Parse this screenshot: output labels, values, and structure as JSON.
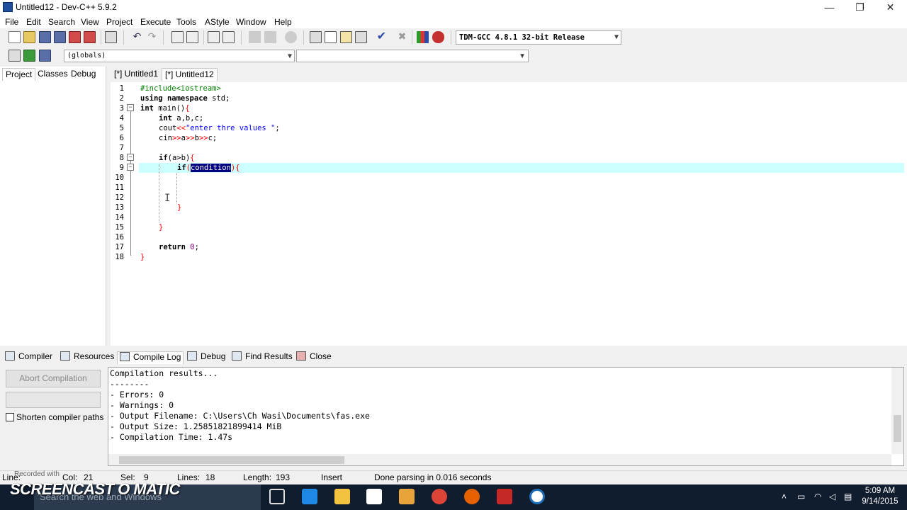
{
  "window": {
    "title": "Untitled12 - Dev-C++ 5.9.2",
    "minimize_glyph": "—",
    "restore_glyph": "❐",
    "close_glyph": "✕"
  },
  "menu": [
    "File",
    "Edit",
    "Search",
    "View",
    "Project",
    "Execute",
    "Tools",
    "AStyle",
    "Window",
    "Help"
  ],
  "toolbar": {
    "compiler": "TDM-GCC 4.8.1 32-bit Release",
    "scope": "(globals)"
  },
  "left_tabs": [
    "Project",
    "Classes",
    "Debug"
  ],
  "file_tabs": [
    "[*] Untitled1",
    "[*] Untitled12"
  ],
  "editor": {
    "line_numbers": [
      "1",
      "2",
      "3",
      "4",
      "5",
      "6",
      "7",
      "8",
      "9",
      "10",
      "11",
      "12",
      "13",
      "14",
      "15",
      "16",
      "17",
      "18"
    ],
    "lines": {
      "l1_pp": "#include<iostream>",
      "l2_kw1": "using",
      "l2_kw2": "namespace",
      "l2_rest": " std;",
      "l3_kw": "int",
      "l3_rest": " main()",
      "l3_brace": "{",
      "l4_kw": "int",
      "l4_rest": " a,b,c;",
      "l5_a": "cout",
      "l5_op": "<<",
      "l5_str": "\"enter thre values \"",
      "l5_end": ";",
      "l6_a": "cin",
      "l6_op1": ">>",
      "l6_b": "a",
      "l6_op2": ">>",
      "l6_c": "b",
      "l6_op3": ">>",
      "l6_d": "c;",
      "l8_kw": "if",
      "l8_rest": "(a>b)",
      "l8_brace": "{",
      "l9_kw": "if",
      "l9_paren1": "(",
      "l9_sel": "condition",
      "l9_paren2": ")",
      "l9_brace": "{",
      "l13_brace": "}",
      "l15_brace": "}",
      "l17_kw": "return",
      "l17_num": "0",
      "l17_end": ";",
      "l18_brace": "}"
    }
  },
  "bottom_tabs": [
    "Compiler",
    "Resources",
    "Compile Log",
    "Debug",
    "Find Results",
    "Close"
  ],
  "compile_panel": {
    "abort_label": "Abort Compilation",
    "shorten_label": "Shorten compiler paths",
    "log": [
      "Compilation results...",
      "--------",
      "- Errors: 0",
      "- Warnings: 0",
      "- Output Filename: C:\\Users\\Ch Wasi\\Documents\\fas.exe",
      "- Output Size: 1.25851821899414 MiB",
      "- Compilation Time: 1.47s"
    ]
  },
  "status": {
    "line_label": "Line:",
    "col_label": "Col:",
    "col_value": "21",
    "sel_label": "Sel:",
    "sel_value": "9",
    "lines_label": "Lines:",
    "lines_value": "18",
    "length_label": "Length:",
    "length_value": "193",
    "mode": "Insert",
    "message": "Done parsing in 0.016 seconds"
  },
  "taskbar": {
    "search_placeholder": "Search the web and Windows",
    "time": "5:09 AM",
    "date": "9/14/2015"
  },
  "watermark": {
    "sub": "Recorded with",
    "main": "SCREENCAST O MATIC"
  }
}
